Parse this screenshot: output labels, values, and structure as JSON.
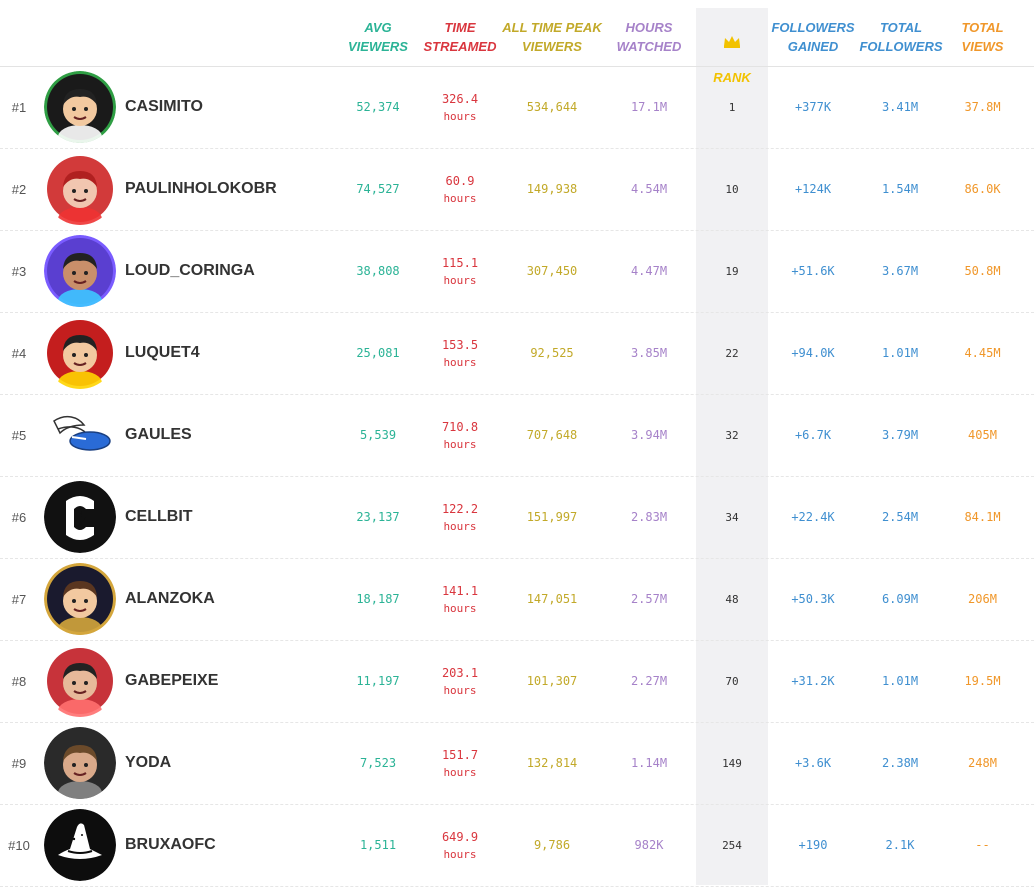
{
  "header": {
    "avg_viewers": "AVG\nVIEWERS",
    "time_streamed": "TIME\nSTREAMED",
    "all_time_peak": "ALL TIME PEAK\nVIEWERS",
    "hours_watched": "HOURS\nWATCHED",
    "rank": "RANK",
    "followers_gained": "FOLLOWERS\nGAINED",
    "total_followers": "TOTAL\nFOLLOWERS",
    "total_views": "TOTAL\nVIEWS",
    "rank_icon": "crown-icon"
  },
  "colors": {
    "avg": "#2bb396",
    "time": "#d9363e",
    "peak": "#c2a929",
    "hours": "#a682c9",
    "rank_header": "#f2c200",
    "followers": "#3f8fd0",
    "views": "#f0972a"
  },
  "rows": [
    {
      "pos": "#1",
      "name": "CASIMITO",
      "avg": "52,374",
      "time": "326.4",
      "time_unit": "hours",
      "peak": "534,644",
      "hours": "17.1M",
      "rank": "1",
      "fgain": "+377K",
      "tfollowers": "3.41M",
      "tviews": "37.8M"
    },
    {
      "pos": "#2",
      "name": "PAULINHOLOKOBR",
      "avg": "74,527",
      "time": "60.9",
      "time_unit": "hours",
      "peak": "149,938",
      "hours": "4.54M",
      "rank": "10",
      "fgain": "+124K",
      "tfollowers": "1.54M",
      "tviews": "86.0K"
    },
    {
      "pos": "#3",
      "name": "LOUD_CORINGA",
      "avg": "38,808",
      "time": "115.1",
      "time_unit": "hours",
      "peak": "307,450",
      "hours": "4.47M",
      "rank": "19",
      "fgain": "+51.6K",
      "tfollowers": "3.67M",
      "tviews": "50.8M"
    },
    {
      "pos": "#4",
      "name": "LUQUET4",
      "avg": "25,081",
      "time": "153.5",
      "time_unit": "hours",
      "peak": "92,525",
      "hours": "3.85M",
      "rank": "22",
      "fgain": "+94.0K",
      "tfollowers": "1.01M",
      "tviews": "4.45M"
    },
    {
      "pos": "#5",
      "name": "GAULES",
      "avg": "5,539",
      "time": "710.8",
      "time_unit": "hours",
      "peak": "707,648",
      "hours": "3.94M",
      "rank": "32",
      "fgain": "+6.7K",
      "tfollowers": "3.79M",
      "tviews": "405M"
    },
    {
      "pos": "#6",
      "name": "CELLBIT",
      "avg": "23,137",
      "time": "122.2",
      "time_unit": "hours",
      "peak": "151,997",
      "hours": "2.83M",
      "rank": "34",
      "fgain": "+22.4K",
      "tfollowers": "2.54M",
      "tviews": "84.1M"
    },
    {
      "pos": "#7",
      "name": "ALANZOKA",
      "avg": "18,187",
      "time": "141.1",
      "time_unit": "hours",
      "peak": "147,051",
      "hours": "2.57M",
      "rank": "48",
      "fgain": "+50.3K",
      "tfollowers": "6.09M",
      "tviews": "206M"
    },
    {
      "pos": "#8",
      "name": "GABEPEIXE",
      "avg": "11,197",
      "time": "203.1",
      "time_unit": "hours",
      "peak": "101,307",
      "hours": "2.27M",
      "rank": "70",
      "fgain": "+31.2K",
      "tfollowers": "1.01M",
      "tviews": "19.5M"
    },
    {
      "pos": "#9",
      "name": "YODA",
      "avg": "7,523",
      "time": "151.7",
      "time_unit": "hours",
      "peak": "132,814",
      "hours": "1.14M",
      "rank": "149",
      "fgain": "+3.6K",
      "tfollowers": "2.38M",
      "tviews": "248M"
    },
    {
      "pos": "#10",
      "name": "BRUXAOFC",
      "avg": "1,511",
      "time": "649.9",
      "time_unit": "hours",
      "peak": "9,786",
      "hours": "982K",
      "rank": "254",
      "fgain": "+190",
      "tfollowers": "2.1K",
      "tviews": "--"
    }
  ]
}
